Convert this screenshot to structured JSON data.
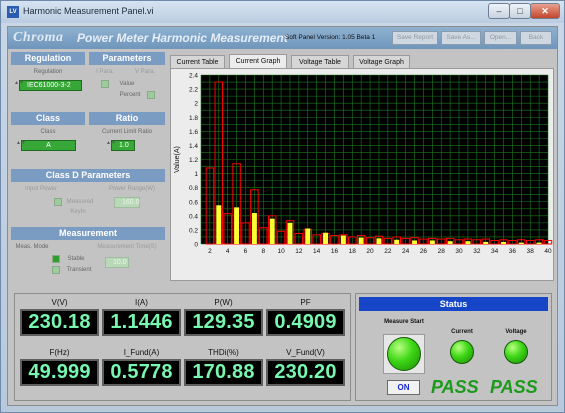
{
  "window": {
    "title": "Harmonic Measurement Panel.vi",
    "app_icon": "labview-icon"
  },
  "header": {
    "brand": "Chroma",
    "subtitle": "Power Meter Harmonic Measurement",
    "version": "Soft Panel Version: 1.05 Beta 1",
    "buttons": [
      "Save Report",
      "Save As...",
      "Open...",
      "Back"
    ]
  },
  "regulation": {
    "title": "Regulation",
    "label": "Regulation",
    "value": "IEC61000-3-2"
  },
  "parameters": {
    "title": "Parameters",
    "col1": "I Para.",
    "col2": "V Para.",
    "value_label": "Value",
    "percent_label": "Percent"
  },
  "class": {
    "title": "Class",
    "label": "Class",
    "value": "A"
  },
  "ratio": {
    "title": "Ratio",
    "label": "Current Limit Ratio",
    "value": "1.0"
  },
  "classd": {
    "title": "Class D Parameters",
    "input_power": "Input Power",
    "power_range": "Power Range(W)",
    "measured": "Measured",
    "keyin": "KeyIn",
    "range_value": "160.0"
  },
  "measurement": {
    "title": "Measurement",
    "meas_mode": "Meas. Mode",
    "timesel": "Measurement Time(S)",
    "stable": "Stable",
    "transient": "Transient",
    "time_value": "10.0"
  },
  "tabs": [
    {
      "label": "Current Table",
      "active": false
    },
    {
      "label": "Current Graph",
      "active": true
    },
    {
      "label": "Voltage Table",
      "active": false
    },
    {
      "label": "Voltage Graph",
      "active": false
    }
  ],
  "chart_data": {
    "type": "bar",
    "ylabel": "Value(A)",
    "xlabel": "",
    "x_ticks": [
      2,
      4,
      6,
      8,
      10,
      12,
      14,
      16,
      18,
      20,
      22,
      24,
      26,
      28,
      30,
      32,
      34,
      36,
      38,
      40
    ],
    "y_ticks": [
      "0",
      "0.2",
      "0.4",
      "0.6",
      "0.8",
      "1",
      "1.2",
      "1.4",
      "1.6",
      "1.8",
      "2",
      "2.2",
      "2.4"
    ],
    "ylim": [
      0,
      2.4
    ],
    "xlim": [
      1,
      40
    ],
    "grid": true,
    "colors": {
      "background": "#000000",
      "grid": "#1f7a1f",
      "measured": "#ffff33",
      "limit": "#ff0000"
    },
    "series": [
      {
        "name": "measured",
        "x": [
          3,
          5,
          7,
          9,
          11,
          13,
          15,
          17,
          19,
          21,
          23,
          25,
          27,
          29,
          31,
          33,
          35,
          37,
          39
        ],
        "values": [
          0.55,
          0.52,
          0.44,
          0.36,
          0.3,
          0.22,
          0.16,
          0.12,
          0.09,
          0.08,
          0.06,
          0.05,
          0.05,
          0.04,
          0.04,
          0.03,
          0.03,
          0.02,
          0.02
        ]
      },
      {
        "name": "limit",
        "x": [
          2,
          3,
          4,
          5,
          6,
          7,
          8,
          9,
          10,
          11,
          12,
          13,
          14,
          15,
          16,
          17,
          18,
          19,
          20,
          21,
          22,
          23,
          24,
          25,
          26,
          27,
          28,
          29,
          30,
          31,
          32,
          33,
          34,
          35,
          36,
          37,
          38,
          39,
          40
        ],
        "values": [
          1.08,
          2.3,
          0.43,
          1.14,
          0.3,
          0.77,
          0.23,
          0.4,
          0.18,
          0.33,
          0.15,
          0.21,
          0.13,
          0.15,
          0.12,
          0.13,
          0.1,
          0.12,
          0.09,
          0.11,
          0.08,
          0.1,
          0.08,
          0.09,
          0.07,
          0.08,
          0.07,
          0.08,
          0.06,
          0.07,
          0.06,
          0.07,
          0.05,
          0.06,
          0.05,
          0.06,
          0.05,
          0.06,
          0.05
        ]
      }
    ]
  },
  "readings": [
    {
      "label": "V(V)",
      "value": "230.18"
    },
    {
      "label": "I(A)",
      "value": "1.1446"
    },
    {
      "label": "P(W)",
      "value": "129.35"
    },
    {
      "label": "PF",
      "value": "0.4909"
    },
    {
      "label": "F(Hz)",
      "value": "49.999"
    },
    {
      "label": "I_Fund(A)",
      "value": "0.5778"
    },
    {
      "label": "THDi(%)",
      "value": "170.88"
    },
    {
      "label": "V_Fund(V)",
      "value": "230.20"
    }
  ],
  "status": {
    "title": "Status",
    "measure_start": "Measure Start",
    "on_label": "ON",
    "current_label": "Current",
    "voltage_label": "Voltage",
    "current_result": "PASS",
    "voltage_result": "PASS"
  }
}
